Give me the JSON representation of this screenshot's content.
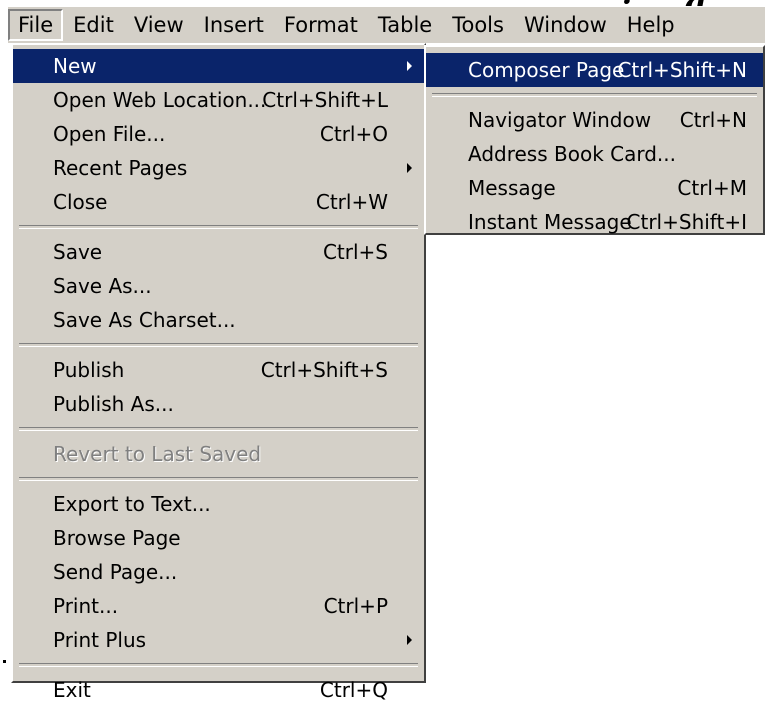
{
  "header_fragment": ", … , … , … ; … g",
  "menubar": {
    "items": [
      {
        "label": "File",
        "active": true
      },
      {
        "label": "Edit"
      },
      {
        "label": "View"
      },
      {
        "label": "Insert"
      },
      {
        "label": "Format"
      },
      {
        "label": "Table"
      },
      {
        "label": "Tools"
      },
      {
        "label": "Window"
      },
      {
        "label": "Help"
      }
    ]
  },
  "file_menu": {
    "items": [
      {
        "label": "New",
        "shortcut": "",
        "submenu": true,
        "highlighted": true
      },
      {
        "label": "Open Web Location...",
        "shortcut": "Ctrl+Shift+L"
      },
      {
        "label": "Open File...",
        "shortcut": "Ctrl+O"
      },
      {
        "label": "Recent Pages",
        "shortcut": "",
        "submenu": true
      },
      {
        "label": "Close",
        "shortcut": "Ctrl+W"
      },
      {
        "separator": true
      },
      {
        "label": "Save",
        "shortcut": "Ctrl+S"
      },
      {
        "label": "Save As...",
        "shortcut": ""
      },
      {
        "label": "Save As Charset...",
        "shortcut": ""
      },
      {
        "separator": true
      },
      {
        "label": "Publish",
        "shortcut": "Ctrl+Shift+S"
      },
      {
        "label": "Publish As...",
        "shortcut": ""
      },
      {
        "separator": true
      },
      {
        "label": "Revert to Last Saved",
        "shortcut": "",
        "disabled": true
      },
      {
        "separator": true
      },
      {
        "label": "Export to Text...",
        "shortcut": ""
      },
      {
        "label": "Browse Page",
        "shortcut": ""
      },
      {
        "label": "Send Page...",
        "shortcut": ""
      },
      {
        "label": "Print...",
        "shortcut": "Ctrl+P"
      },
      {
        "label": "Print Plus",
        "shortcut": "",
        "submenu": true
      },
      {
        "separator": true
      },
      {
        "label": "Exit",
        "shortcut": "Ctrl+Q"
      }
    ]
  },
  "new_submenu": {
    "items": [
      {
        "label": "Composer Page",
        "shortcut": "Ctrl+Shift+N",
        "highlighted": true
      },
      {
        "separator": true
      },
      {
        "label": "Navigator Window",
        "shortcut": "Ctrl+N"
      },
      {
        "label": "Address Book Card...",
        "shortcut": ""
      },
      {
        "label": "Message",
        "shortcut": "Ctrl+M"
      },
      {
        "label": "Instant Message",
        "shortcut": "Ctrl+Shift+I"
      }
    ]
  },
  "colors": {
    "menu_bg": "#d4d0c8",
    "highlight": "#0a246a",
    "disabled_text": "#808080"
  }
}
